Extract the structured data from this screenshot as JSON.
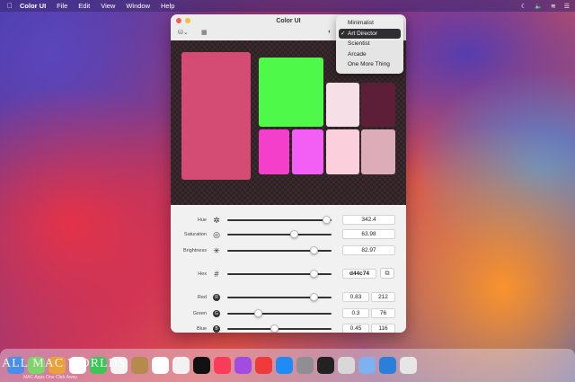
{
  "menubar": {
    "app_name": "Color UI",
    "items": [
      "File",
      "Edit",
      "View",
      "Window",
      "Help"
    ]
  },
  "window": {
    "title": "Color UI",
    "icons": {
      "color_drop": "paint-bucket-icon",
      "grid": "grid-icon",
      "contrast": "contrast-icon"
    }
  },
  "swatches": {
    "colors": {
      "main": "#d44c74",
      "green": "#4ef94a",
      "pale_pink": "#f6dfe7",
      "burgundy": "#5d1f38",
      "magenta_1": "#f43fcb",
      "magenta_2": "#f35ef5",
      "light_pink": "#fbcfdc",
      "dusty_pink": "#dcadb9"
    }
  },
  "controls": {
    "hue": {
      "label": "Hue",
      "value": "342.4",
      "level": 0.95
    },
    "saturation": {
      "label": "Saturation",
      "value": "63.98",
      "level": 0.64
    },
    "brightness": {
      "label": "Brightness",
      "value": "82.97",
      "level": 0.83
    },
    "hex": {
      "label": "Hex",
      "value": "d44c74",
      "level": 0.83,
      "icon": "#"
    },
    "red": {
      "label": "Red",
      "value": "0.83",
      "value_int": "212",
      "level": 0.83,
      "icon": "R"
    },
    "green": {
      "label": "Green",
      "value": "0.3",
      "value_int": "76",
      "level": 0.3,
      "icon": "G"
    },
    "blue": {
      "label": "Blue",
      "value": "0.45",
      "value_int": "116",
      "level": 0.45,
      "icon": "B"
    }
  },
  "mode_menu": {
    "items": [
      {
        "label": "Minimalist",
        "selected": false
      },
      {
        "label": "Art Director",
        "selected": true
      },
      {
        "label": "Scientist",
        "selected": false
      },
      {
        "label": "Arcade",
        "selected": false
      },
      {
        "label": "One More Thing",
        "selected": false
      }
    ],
    "check": "✓"
  },
  "watermark": {
    "text": "ALL MAC WORLDS",
    "sub": "MAC Apps One Click Away"
  },
  "dock": {
    "colors": [
      "#4a8ee8",
      "#7ed36b",
      "#e9a23b",
      "#ffffff",
      "#3dc55a",
      "#f5f5f5",
      "#b58a4c",
      "#ffffff",
      "#f2f2f2",
      "#111111",
      "#fa3c5a",
      "#a24de0",
      "#f03a3a",
      "#1f8cf5",
      "#8e8e93",
      "#222222",
      "#d8d8d8",
      "#7fb0f0",
      "#2a7fd8",
      "#e6e6e6"
    ]
  }
}
